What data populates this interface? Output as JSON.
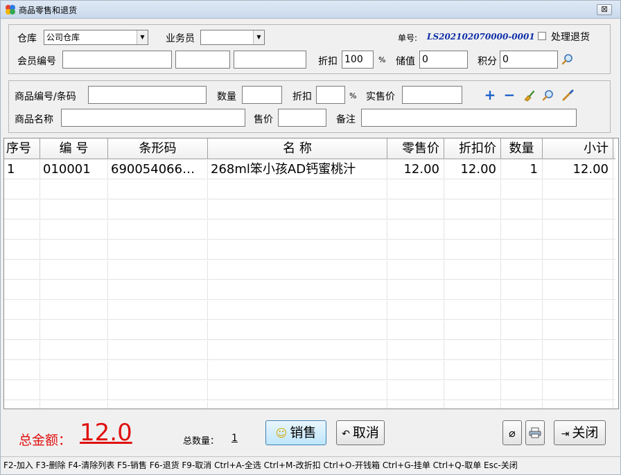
{
  "window": {
    "title": "商品零售和退货",
    "close_label": "⊠"
  },
  "header": {
    "warehouse_label": "仓库",
    "warehouse_value": "公司仓库",
    "salesperson_label": "业务员",
    "salesperson_value": "",
    "order_no_label": "单号:",
    "order_no_value": "LS202102070000-0001",
    "return_checkbox_label": "处理退货",
    "member_no_label": "会员编号",
    "member_no_value": "",
    "member_field2_value": "",
    "member_field3_value": "",
    "discount_label": "折扣",
    "discount_value": "100",
    "discount_pct": "%",
    "stored_value_label": "储值",
    "stored_value": "0",
    "points_label": "积分",
    "points_value": "0"
  },
  "entry": {
    "product_code_label": "商品编号/条码",
    "product_code_value": "",
    "quantity_label": "数量",
    "quantity_value": "",
    "discount_label": "折扣",
    "discount_value": "",
    "discount_pct": "%",
    "actual_price_label": "实售价",
    "actual_price_value": "",
    "product_name_label": "商品名称",
    "product_name_value": "",
    "sale_price_label": "售价",
    "sale_price_value": "",
    "remark_label": "备注",
    "remark_value": ""
  },
  "table": {
    "columns": [
      "序号",
      "编  号",
      "条形码",
      "名    称",
      "零售价",
      "折扣价",
      "数量",
      "小计"
    ],
    "rows": [
      [
        "1",
        "010001",
        "690054066…",
        "268ml笨小孩AD钙蜜桃汁",
        "12.00",
        "12.00",
        "1",
        "12.00"
      ]
    ]
  },
  "footer": {
    "total_label": "总金额：",
    "total_value": "12.0",
    "total_qty_label": "总数量：",
    "total_qty_value": "1",
    "sell_label": "销售",
    "cancel_label": "取消",
    "close_label": "关闭"
  },
  "statusbar": {
    "text": "F2-加入 F3-删除 F4-清除列表 F5-销售 F6-退货 F9-取消 Ctrl+A-全选 Ctrl+M-改折扣  Ctrl+O-开钱箱 Ctrl+G-挂单 Ctrl+Q-取单 Esc-关闭"
  },
  "colors": {
    "accent_red": "#e01010",
    "order_no_blue": "#0e2fa8",
    "add_icon_blue": "#1a5fc8"
  }
}
